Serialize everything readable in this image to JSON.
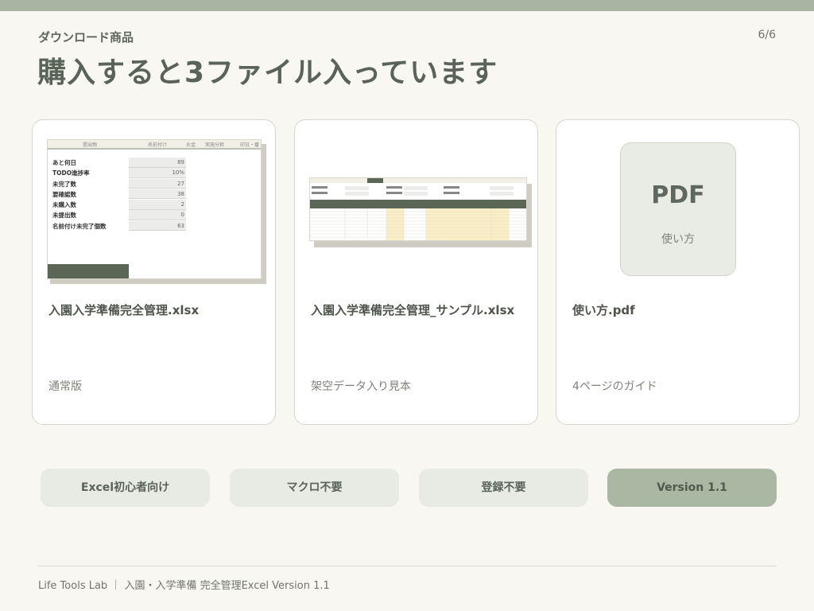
{
  "header": {
    "eyebrow": "ダウンロード商品",
    "title": "購入すると3ファイル入っています",
    "page": "6/6"
  },
  "cards": [
    {
      "title": "入園入学準備完全管理.xlsx",
      "subtitle": "通常版",
      "thumbnail": {
        "headers": [
          "提出物",
          "名前付け",
          "お金",
          "実施分担",
          "印日・番"
        ],
        "rows": [
          {
            "label": "あと何日",
            "value": "89"
          },
          {
            "label": "TODO進捗率",
            "value": "10%"
          },
          {
            "label": "未完了数",
            "value": "27"
          },
          {
            "label": "要確認数",
            "value": "38"
          },
          {
            "label": "未購入数",
            "value": "2"
          },
          {
            "label": "未提出数",
            "value": "0"
          },
          {
            "label": "名前付け未完了個数",
            "value": "63"
          }
        ]
      }
    },
    {
      "title": "入園入学準備完全管理_サンプル.xlsx",
      "subtitle": "架空データ入り見本"
    },
    {
      "title": "使い方.pdf",
      "subtitle": "4ページのガイド",
      "icon_label": "PDF",
      "icon_caption": "使い方"
    }
  ],
  "tags": [
    "Excel初心者向け",
    "マクロ不要",
    "登録不要",
    "Version 1.1"
  ],
  "footer": "Life Tools Lab ｜ 入園・入学準備 完全管理Excel  Version 1.1",
  "colors": {
    "background": "#f9f7f1",
    "accent": "#a9b5a2",
    "text": "#5a6357"
  }
}
